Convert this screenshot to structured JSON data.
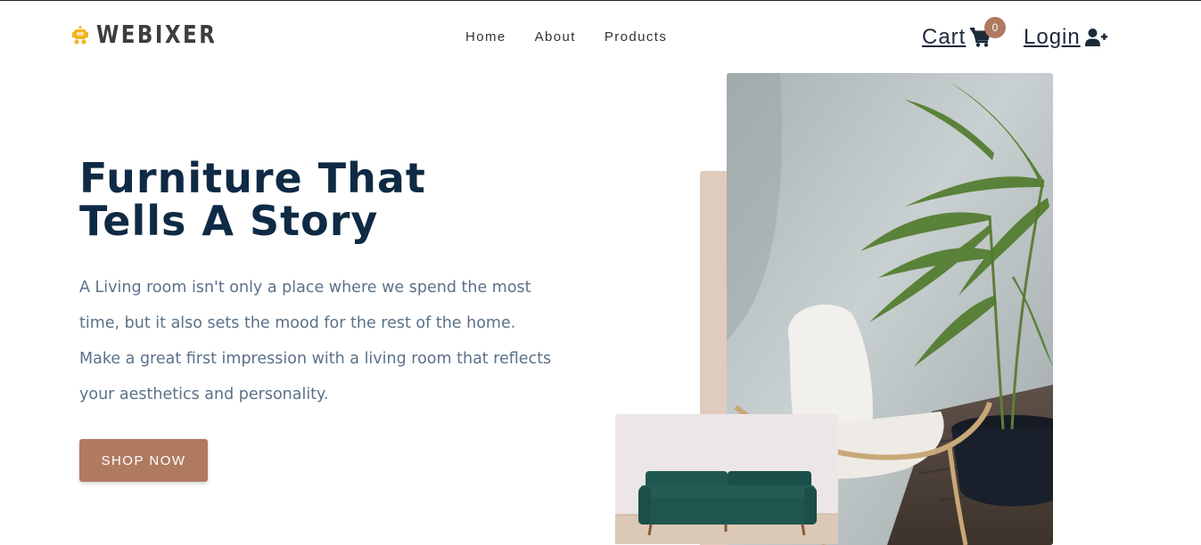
{
  "brand": {
    "name": "WEBIXER",
    "logo_color": "#f2b51f"
  },
  "nav": {
    "links": [
      "Home",
      "About",
      "Products"
    ]
  },
  "cart": {
    "label": "Cart",
    "count": "0",
    "badge_color": "#b07a60"
  },
  "login": {
    "label": "Login"
  },
  "hero": {
    "title_line1": "Furniture That",
    "title_line2": "Tells A Story",
    "description": "A Living room isn't only a place where we spend the most time, but it also sets the mood for the rest of the home. Make a great first impression with a living room that reflects your aesthetics and personality.",
    "button_label": "SHOP NOW"
  },
  "colors": {
    "title": "#0f2a44",
    "description": "#5b7189",
    "accent": "#b07a60",
    "panel": "#e0cbbf"
  }
}
